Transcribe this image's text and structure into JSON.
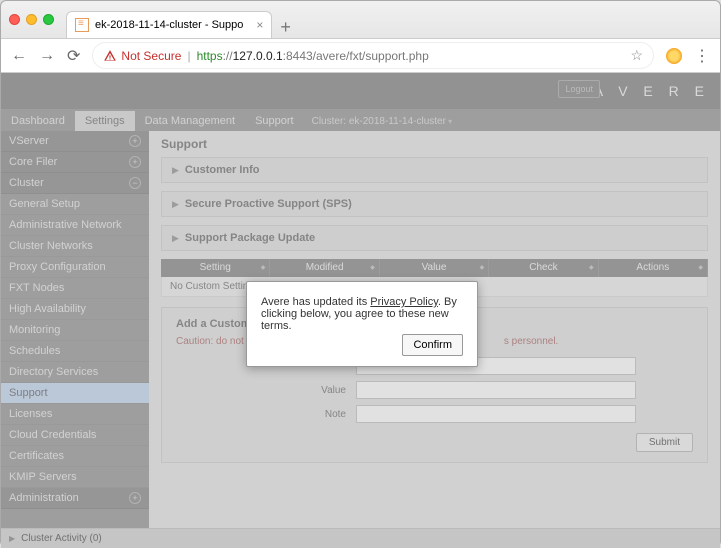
{
  "browser": {
    "tab_title": "ek-2018-11-14-cluster - Suppo",
    "not_secure": "Not Secure",
    "url_scheme": "https",
    "url_host": "127.0.0.1",
    "url_port": ":8443",
    "url_path": "/avere/fxt/support.php"
  },
  "topband": {
    "logout": "Logout",
    "logo": "A V E R E"
  },
  "tabs": {
    "items": [
      "Dashboard",
      "Settings",
      "Data Management",
      "Support"
    ],
    "active_index": 1,
    "cluster_label": "Cluster: ek-2018-11-14-cluster"
  },
  "sidebar": {
    "groups": [
      {
        "label": "VServer",
        "items": []
      },
      {
        "label": "Core Filer",
        "items": []
      },
      {
        "label": "Cluster",
        "items": [
          "General Setup",
          "Administrative Network",
          "Cluster Networks",
          "Proxy Configuration",
          "FXT Nodes",
          "High Availability",
          "Monitoring",
          "Schedules",
          "Directory Services",
          "Support",
          "Licenses",
          "Cloud Credentials",
          "Certificates",
          "KMIP Servers"
        ],
        "selected": "Support"
      },
      {
        "label": "Administration",
        "items": []
      }
    ]
  },
  "main": {
    "heading": "Support",
    "panels": [
      "Customer Info",
      "Secure Proactive Support (SPS)",
      "Support Package Update"
    ],
    "table_headers": [
      "Setting",
      "Modified",
      "Value",
      "Check",
      "Actions"
    ],
    "empty_row": "No Custom Settings f",
    "form": {
      "title": "Add a Custom Se",
      "caution_pre": "Caution: do not chan",
      "caution_post": "s personnel.",
      "fields": [
        "",
        "Value",
        "Note"
      ],
      "submit": "Submit"
    }
  },
  "footer": "Cluster Activity (0)",
  "modal": {
    "text_pre": "Avere has updated its ",
    "pp": "Privacy Policy",
    "text_post": ". By clicking below, you agree to these new terms.",
    "confirm": "Confirm"
  }
}
